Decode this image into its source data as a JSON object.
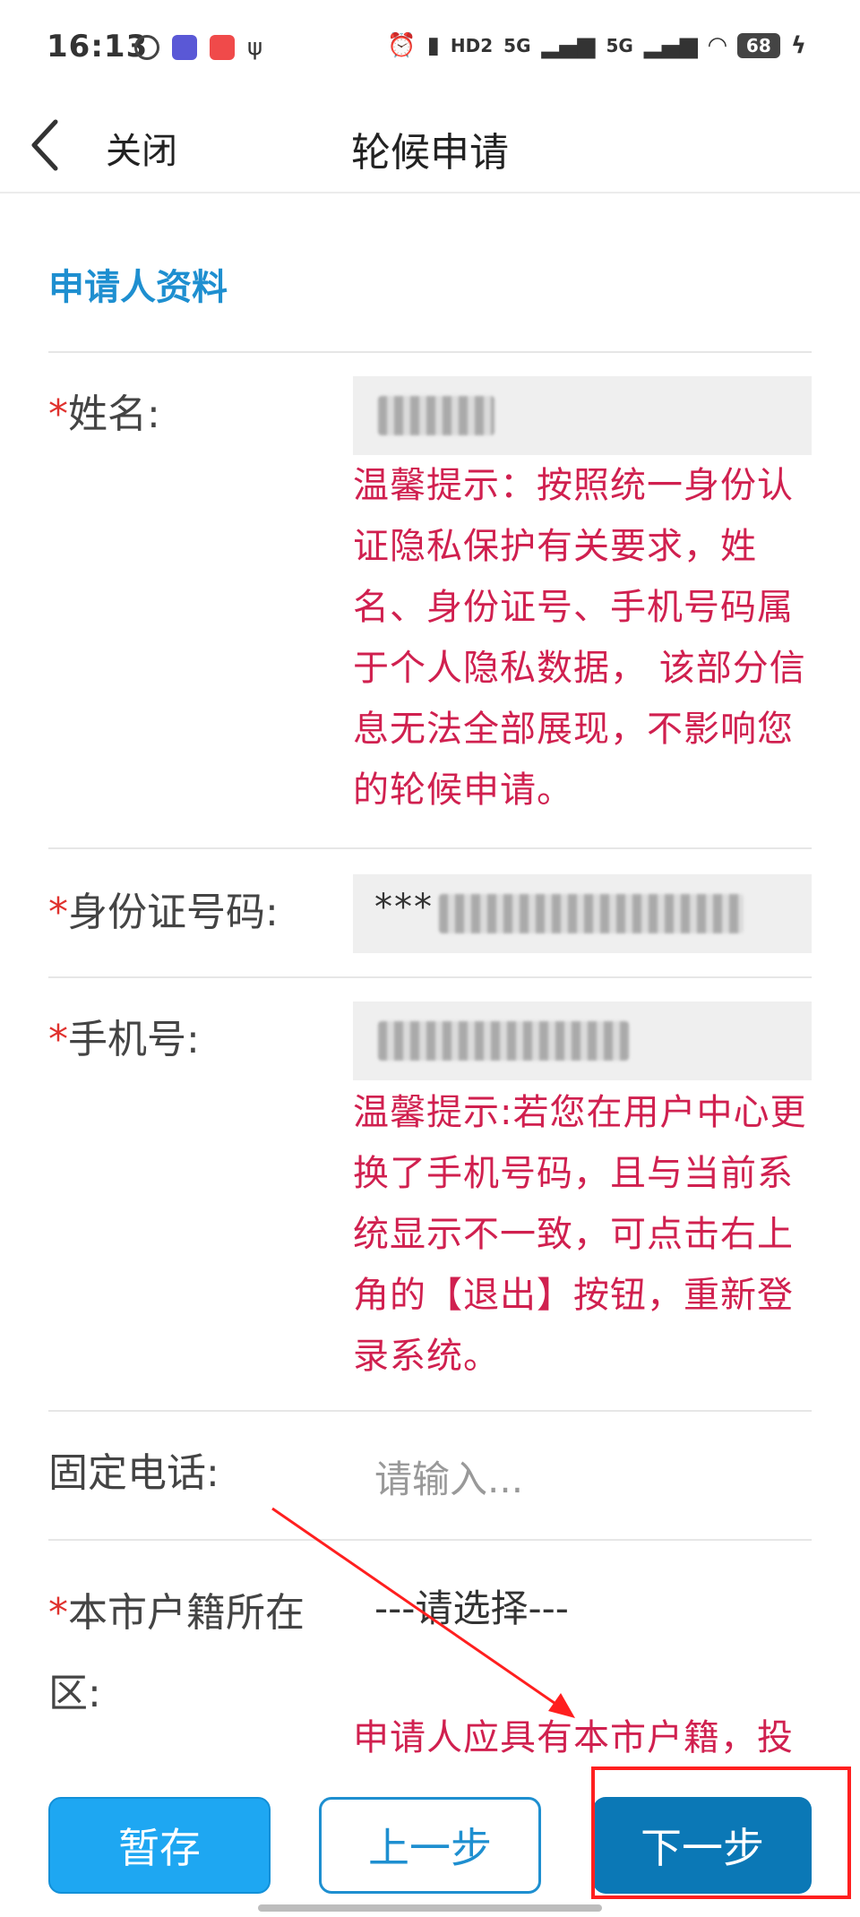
{
  "status_bar": {
    "time": "16:13",
    "battery": "68",
    "network": [
      "HD2",
      "5G",
      "5G"
    ],
    "icons": [
      "link-icon",
      "sticker-app-icon",
      "red-app-icon",
      "usb-icon",
      "alarm-icon",
      "vibrate-icon",
      "wifi-icon",
      "charging-icon"
    ]
  },
  "nav": {
    "back_icon": "chevron-left-icon",
    "close_label": "关闭",
    "title": "轮候申请"
  },
  "section": {
    "title": "申请人资料"
  },
  "form": {
    "required_mark": "*",
    "name": {
      "label": "姓名:",
      "hint": "温馨提示：按照统一身份认证隐私保护有关要求，姓名、身份证号、手机号码属于个人隐私数据， 该部分信息无法全部展现，不影响您的轮候申请。"
    },
    "id_number": {
      "label": "身份证号码:",
      "value_prefix": "***"
    },
    "phone": {
      "label": "手机号:",
      "hint": "温馨提示:若您在用户中心更换了手机号码，且与当前系统显示不一致，可点击右上角的【退出】按钮，重新登录系统。"
    },
    "landline": {
      "label": "固定电话:",
      "placeholder": "请输入..."
    },
    "district": {
      "label": "本市户籍所在区:",
      "value": "---请选择---",
      "hint": "申请人应具有本市户籍，投"
    }
  },
  "buttons": {
    "save": "暂存",
    "prev": "上一步",
    "next": "下一步"
  },
  "colors": {
    "accent": "#1e8fd0",
    "hint_red": "#d0204f",
    "next_button": "#0b78b6",
    "annotation_red": "#ff1f1f"
  }
}
